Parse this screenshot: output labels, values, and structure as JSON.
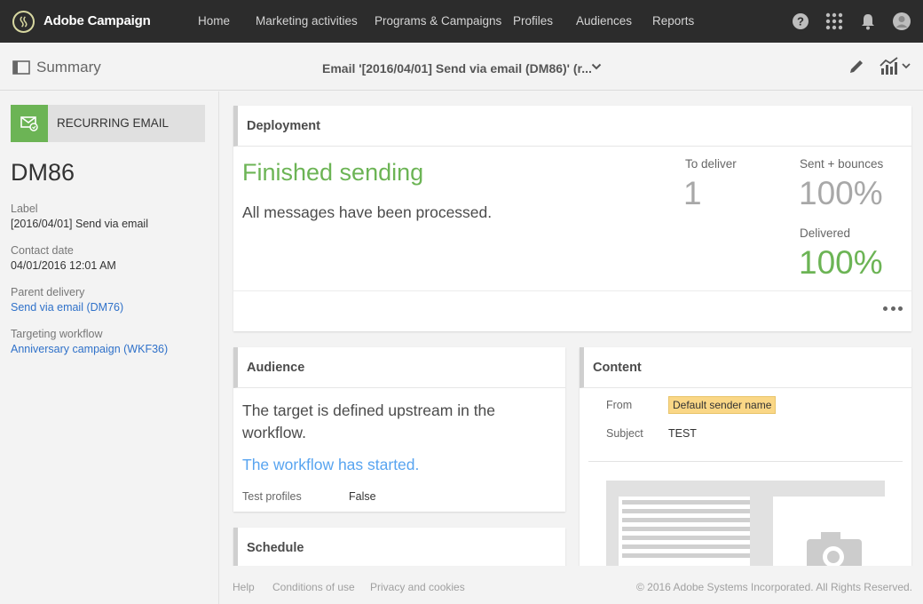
{
  "app": {
    "brand": "Adobe Campaign"
  },
  "nav": {
    "items": [
      "Home",
      "Marketing activities",
      "Programs & Campaigns",
      "Profiles",
      "Audiences",
      "Reports"
    ]
  },
  "header_icons": [
    "help-icon",
    "apps-grid-icon",
    "notification-bell-icon",
    "user-avatar-icon"
  ],
  "subheader": {
    "title": "Summary",
    "delivery_title": "Email '[2016/04/01] Send via email (DM86)' (r..."
  },
  "sidebar": {
    "type_label": "RECURRING EMAIL",
    "code": "DM86",
    "fields": [
      {
        "label": "Label",
        "value": "[2016/04/01] Send via email"
      },
      {
        "label": "Contact date",
        "value": "04/01/2016 12:01 AM"
      },
      {
        "label": "Parent delivery",
        "value": "Send via email (DM76)"
      },
      {
        "label": "Targeting workflow",
        "value": "Anniversary campaign (WKF36)"
      }
    ]
  },
  "deployment": {
    "title": "Deployment",
    "status": "Finished sending",
    "message": "All messages have been processed.",
    "to_deliver_label": "To deliver",
    "to_deliver_value": "1",
    "sent_label": "Sent + bounces",
    "sent_value": "100%",
    "delivered_label": "Delivered",
    "delivered_value": "100%"
  },
  "audience": {
    "title": "Audience",
    "text": "The target is defined upstream in the workflow.",
    "status": "The workflow has started.",
    "test_profiles_label": "Test profiles",
    "test_profiles_value": "False"
  },
  "content": {
    "title": "Content",
    "from_label": "From",
    "from_value": "Default sender name",
    "subject_label": "Subject",
    "subject_value": "TEST"
  },
  "schedule": {
    "title": "Schedule"
  },
  "footer": {
    "links": [
      "Help",
      "Conditions of use",
      "Privacy and cookies"
    ],
    "copyright": "© 2016 Adobe Systems Incorporated. All Rights Reserved."
  },
  "colors": {
    "topbar": "#2c2c2c",
    "accent_green": "#6cb455",
    "link_blue": "#2f71c9",
    "status_blue": "#58a4f0",
    "sender_highlight": "#fad786"
  }
}
